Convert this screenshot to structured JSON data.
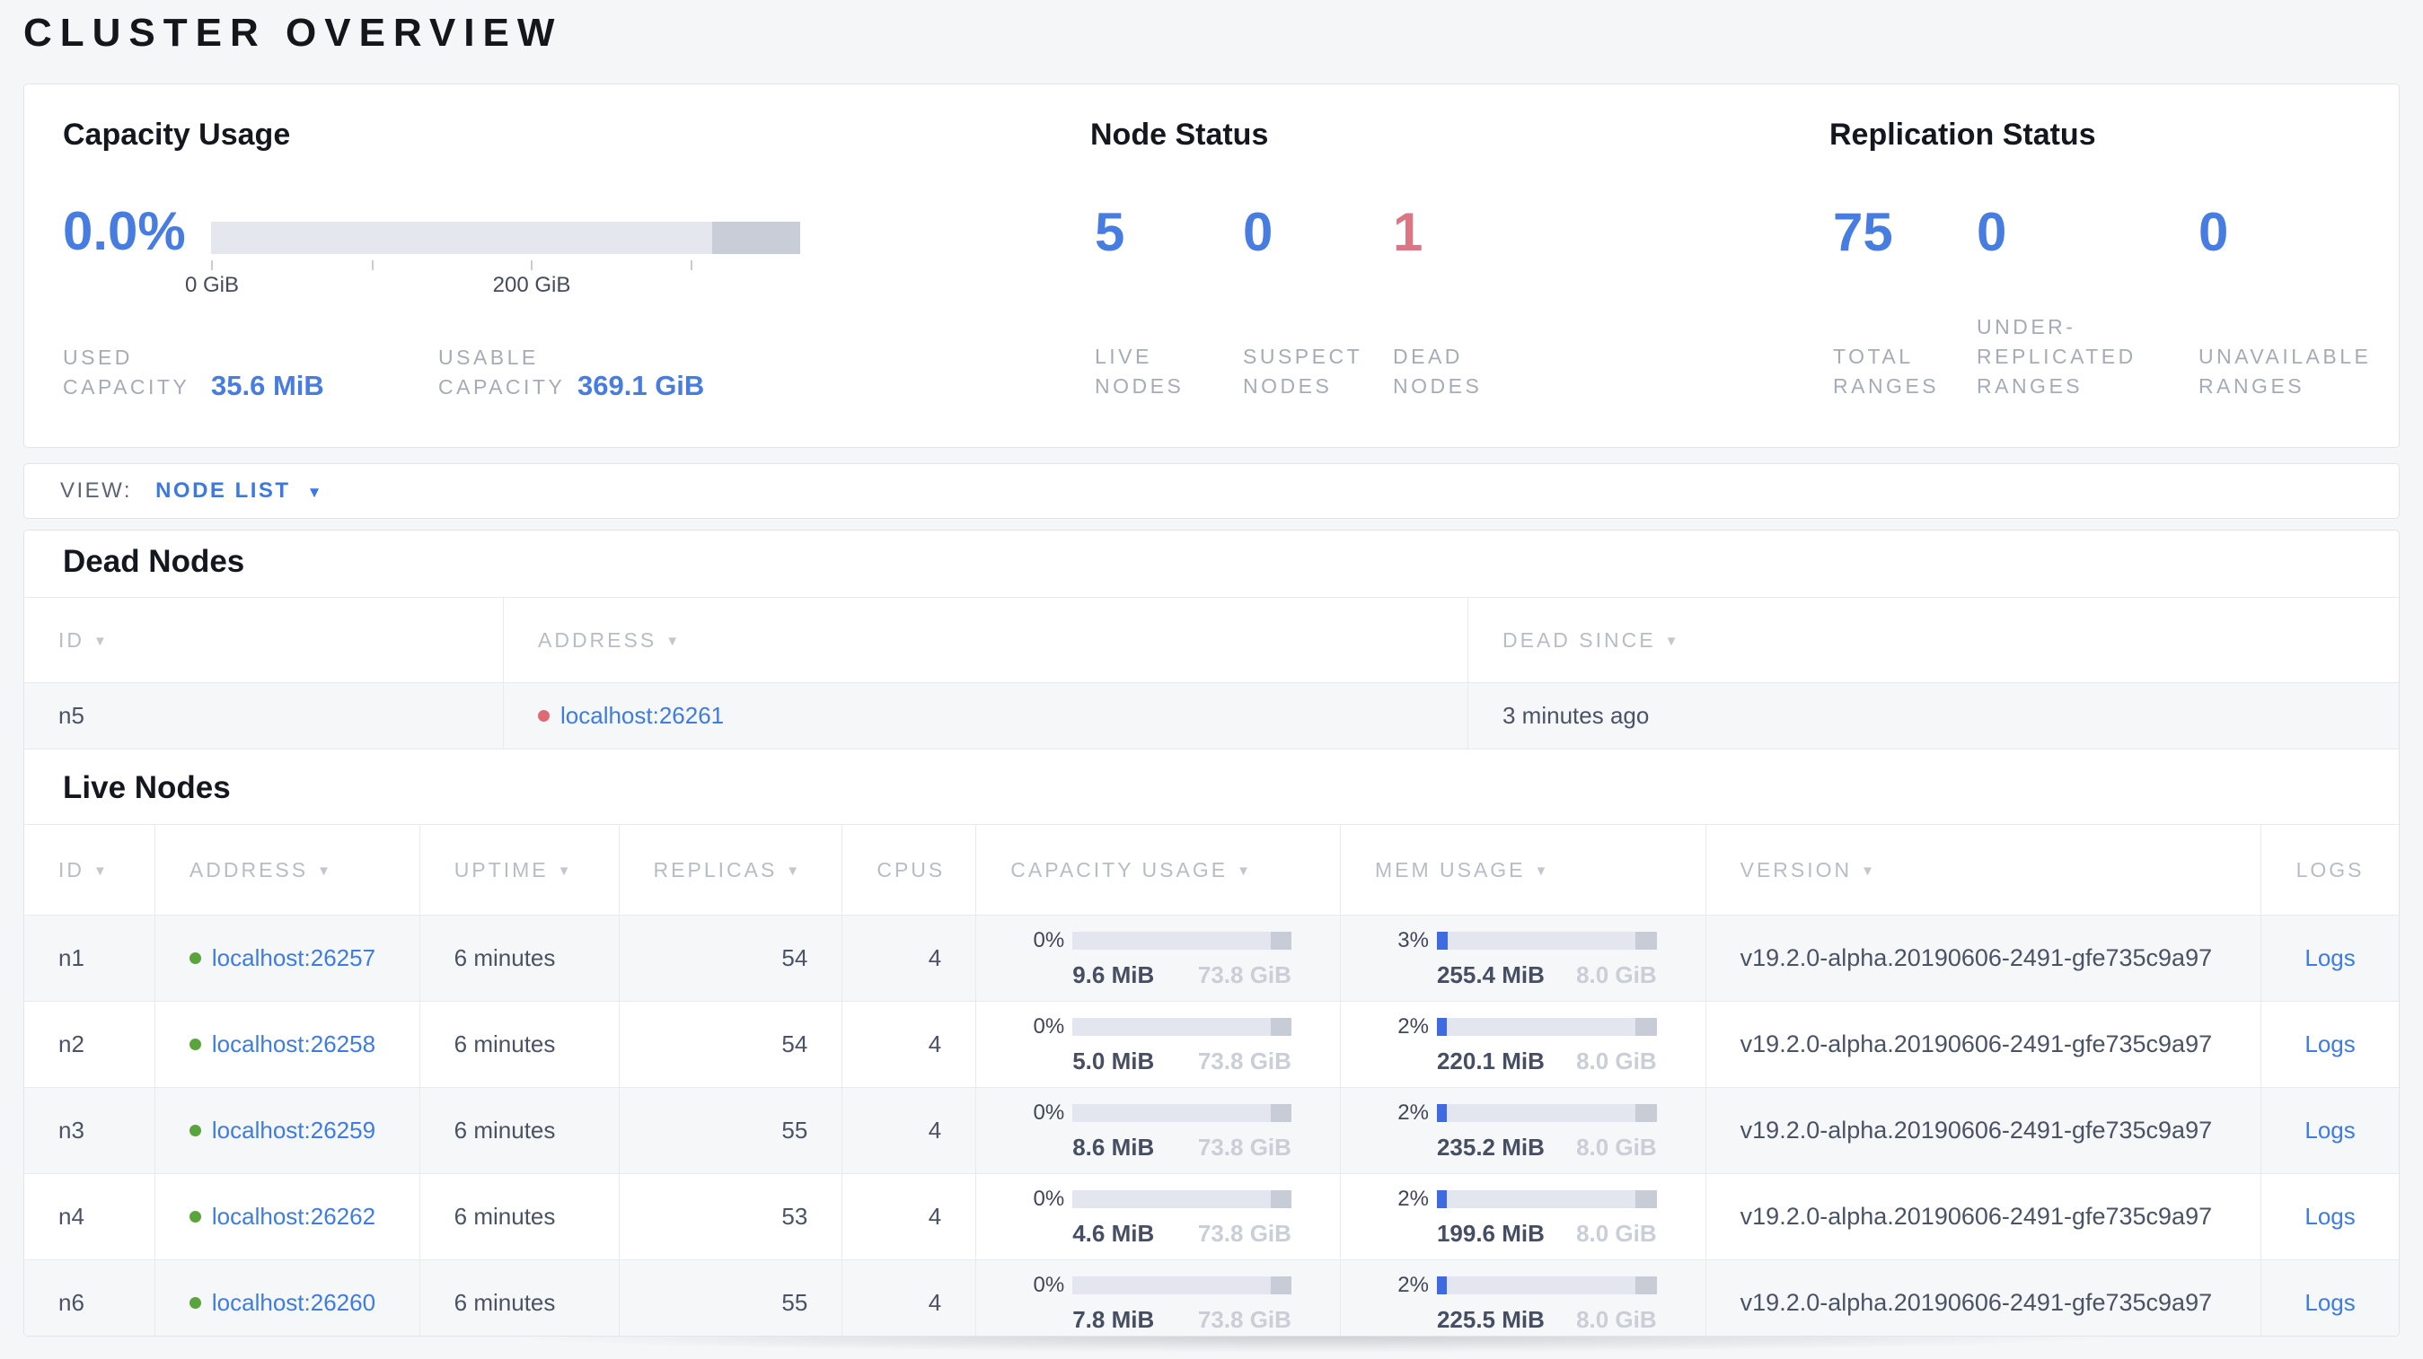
{
  "page": {
    "title": "CLUSTER OVERVIEW"
  },
  "icons": {
    "sort": "▼",
    "caret": "▼"
  },
  "colors": {
    "accent_blue": "#477ce0",
    "link_blue": "#3e7ce0",
    "danger_red": "#dd7586",
    "live_green": "#5aa43c",
    "dead_red": "#dd6a74",
    "bar_track": "#e3e6ee",
    "bar_remainder": "#c7ccd7",
    "bar_fill": "#3f6be0"
  },
  "capacity": {
    "title": "Capacity Usage",
    "percent": "0.0%",
    "bar": {
      "fill": "0%",
      "other_width": "15%"
    },
    "tick_labels": [
      "0 GiB",
      "200 GiB"
    ],
    "used_label": "USED CAPACITY",
    "used_value": "35.6 MiB",
    "usable_label": "USABLE CAPACITY",
    "usable_value": "369.1 GiB"
  },
  "node_status": {
    "title": "Node Status",
    "stats": [
      {
        "value": "5",
        "label": "LIVE NODES"
      },
      {
        "value": "0",
        "label": "SUSPECT NODES"
      },
      {
        "value": "1",
        "label": "DEAD NODES"
      }
    ]
  },
  "replication": {
    "title": "Replication Status",
    "stats": [
      {
        "value": "75",
        "label": "TOTAL RANGES"
      },
      {
        "value": "0",
        "label": "UNDER-REPLICATED RANGES"
      },
      {
        "value": "0",
        "label": "UNAVAILABLE RANGES"
      }
    ]
  },
  "view": {
    "label": "VIEW:",
    "value": "NODE LIST"
  },
  "dead_nodes": {
    "title": "Dead Nodes",
    "columns": [
      {
        "label": "ID"
      },
      {
        "label": "ADDRESS"
      },
      {
        "label": "DEAD SINCE"
      }
    ],
    "rows": [
      {
        "id": "n5",
        "address": "localhost:26261",
        "dead_since": "3 minutes ago"
      }
    ]
  },
  "live_nodes": {
    "title": "Live Nodes",
    "columns": [
      {
        "label": "ID"
      },
      {
        "label": "ADDRESS"
      },
      {
        "label": "UPTIME"
      },
      {
        "label": "REPLICAS"
      },
      {
        "label": "CPUS"
      },
      {
        "label": "CAPACITY USAGE"
      },
      {
        "label": "MEM USAGE"
      },
      {
        "label": "VERSION"
      },
      {
        "label": "LOGS"
      }
    ],
    "rows": [
      {
        "id": "n1",
        "address": "localhost:26257",
        "uptime": "6 minutes",
        "replicas": "54",
        "cpus": "4",
        "capacity": {
          "percent": "0%",
          "used": "9.6 MiB",
          "total": "73.8 GiB",
          "fill": "0%"
        },
        "memory": {
          "percent": "3%",
          "used": "255.4 MiB",
          "total": "8.0 GiB",
          "fill": "5%"
        },
        "version": "v19.2.0-alpha.20190606-2491-gfe735c9a97",
        "logs_label": "Logs"
      },
      {
        "id": "n2",
        "address": "localhost:26258",
        "uptime": "6 minutes",
        "replicas": "54",
        "cpus": "4",
        "capacity": {
          "percent": "0%",
          "used": "5.0 MiB",
          "total": "73.8 GiB",
          "fill": "0%"
        },
        "memory": {
          "percent": "2%",
          "used": "220.1 MiB",
          "total": "8.0 GiB",
          "fill": "4.5%"
        },
        "version": "v19.2.0-alpha.20190606-2491-gfe735c9a97",
        "logs_label": "Logs"
      },
      {
        "id": "n3",
        "address": "localhost:26259",
        "uptime": "6 minutes",
        "replicas": "55",
        "cpus": "4",
        "capacity": {
          "percent": "0%",
          "used": "8.6 MiB",
          "total": "73.8 GiB",
          "fill": "0%"
        },
        "memory": {
          "percent": "2%",
          "used": "235.2 MiB",
          "total": "8.0 GiB",
          "fill": "4.5%"
        },
        "version": "v19.2.0-alpha.20190606-2491-gfe735c9a97",
        "logs_label": "Logs"
      },
      {
        "id": "n4",
        "address": "localhost:26262",
        "uptime": "6 minutes",
        "replicas": "53",
        "cpus": "4",
        "capacity": {
          "percent": "0%",
          "used": "4.6 MiB",
          "total": "73.8 GiB",
          "fill": "0%"
        },
        "memory": {
          "percent": "2%",
          "used": "199.6 MiB",
          "total": "8.0 GiB",
          "fill": "4.5%"
        },
        "version": "v19.2.0-alpha.20190606-2491-gfe735c9a97",
        "logs_label": "Logs"
      },
      {
        "id": "n6",
        "address": "localhost:26260",
        "uptime": "6 minutes",
        "replicas": "55",
        "cpus": "4",
        "capacity": {
          "percent": "0%",
          "used": "7.8 MiB",
          "total": "73.8 GiB",
          "fill": "0%"
        },
        "memory": {
          "percent": "2%",
          "used": "225.5 MiB",
          "total": "8.0 GiB",
          "fill": "4.5%"
        },
        "version": "v19.2.0-alpha.20190606-2491-gfe735c9a97",
        "logs_label": "Logs"
      }
    ]
  }
}
